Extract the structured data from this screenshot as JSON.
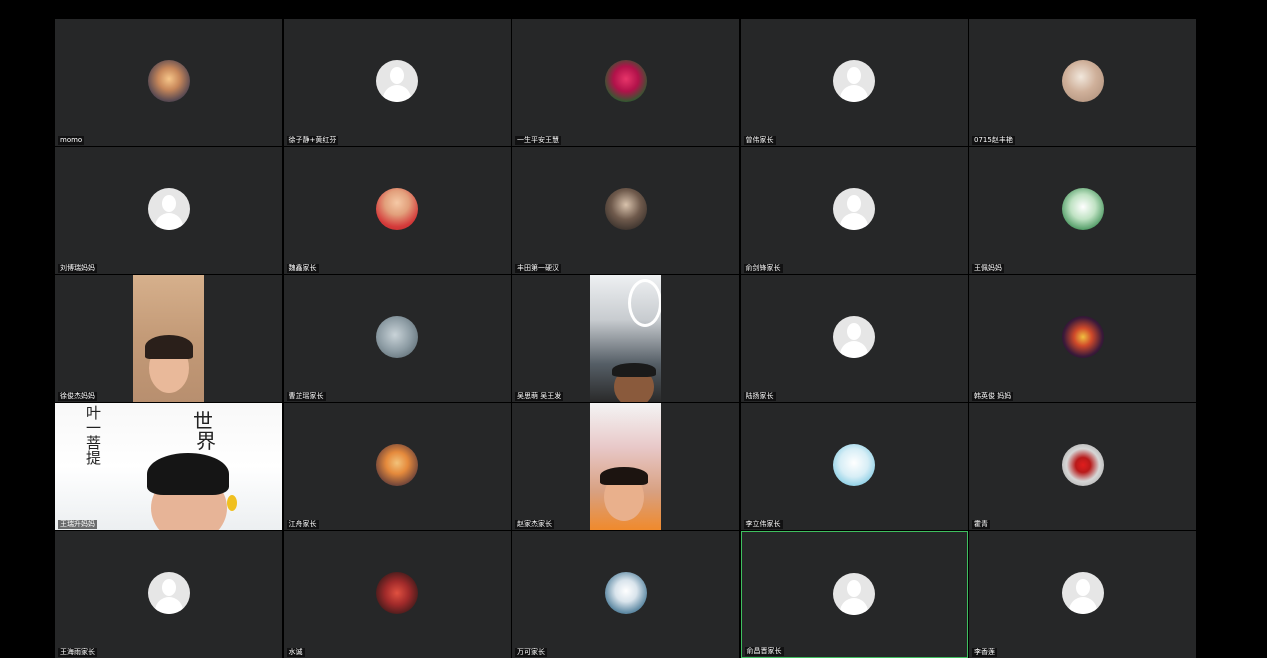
{
  "tiles": [
    {
      "name": "momo",
      "avatar": "photo-1"
    },
    {
      "name": "徐子静+黄红芬",
      "avatar": "default"
    },
    {
      "name": "一生平安王慧",
      "avatar": "photo-2"
    },
    {
      "name": "曾伟家长",
      "avatar": "default"
    },
    {
      "name": "0715赵丰艳",
      "avatar": "photo-3"
    },
    {
      "name": "刘博瑞妈妈",
      "avatar": "default"
    },
    {
      "name": "魏鑫家长",
      "avatar": "photo-4"
    },
    {
      "name": "丰田第一硬汉",
      "avatar": "photo-5"
    },
    {
      "name": "俞剑锋家长",
      "avatar": "default"
    },
    {
      "name": "王佩妈妈",
      "avatar": "photo-6"
    },
    {
      "name": "徐俊杰妈妈",
      "video": "v1"
    },
    {
      "name": "曹芷瑶家长",
      "avatar": "photo-7"
    },
    {
      "name": "吴思萌 吴王发",
      "video": "v2"
    },
    {
      "name": "陆扬家长",
      "avatar": "default"
    },
    {
      "name": "韩英俊 妈妈",
      "avatar": "photo-8"
    },
    {
      "name": "王瑞升妈妈",
      "video": "v3"
    },
    {
      "name": "江舟家长",
      "avatar": "photo-9"
    },
    {
      "name": "赵家杰家长",
      "video": "v4"
    },
    {
      "name": "李立伟家长",
      "avatar": "photo-10"
    },
    {
      "name": "霍青",
      "avatar": "photo-11"
    },
    {
      "name": "王海雨家长",
      "avatar": "default"
    },
    {
      "name": "水诚",
      "avatar": "photo-12"
    },
    {
      "name": "万可家长",
      "avatar": "photo-13"
    },
    {
      "name": "俞昌晋家长",
      "avatar": "default",
      "active": true
    },
    {
      "name": "李香莲",
      "avatar": "default"
    }
  ],
  "whiteboard_text": [
    "叶一菩提",
    "世",
    "界"
  ],
  "colors": {
    "tile_background": "#262728",
    "active_speaker_border": "#3fbf5f",
    "page_background": "#000000"
  }
}
